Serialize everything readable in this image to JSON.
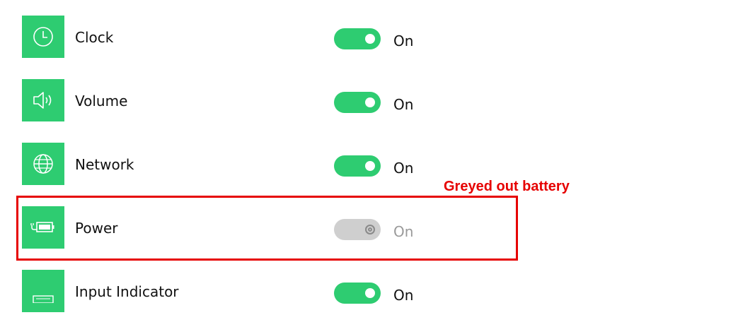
{
  "settings": {
    "items": [
      {
        "label": "Clock",
        "state": "On",
        "icon": "clock-icon"
      },
      {
        "label": "Volume",
        "state": "On",
        "icon": "speaker-icon"
      },
      {
        "label": "Network",
        "state": "On",
        "icon": "globe-icon"
      },
      {
        "label": "Power",
        "state": "On",
        "icon": "battery-plug-icon",
        "disabled": true
      },
      {
        "label": "Input Indicator",
        "state": "On",
        "icon": "keyboard-icon"
      }
    ]
  },
  "annotation": {
    "text": "Greyed out battery",
    "color": "#e60000"
  },
  "colors": {
    "accent": "#2ecc71",
    "disabled": "#cfcfcf"
  }
}
